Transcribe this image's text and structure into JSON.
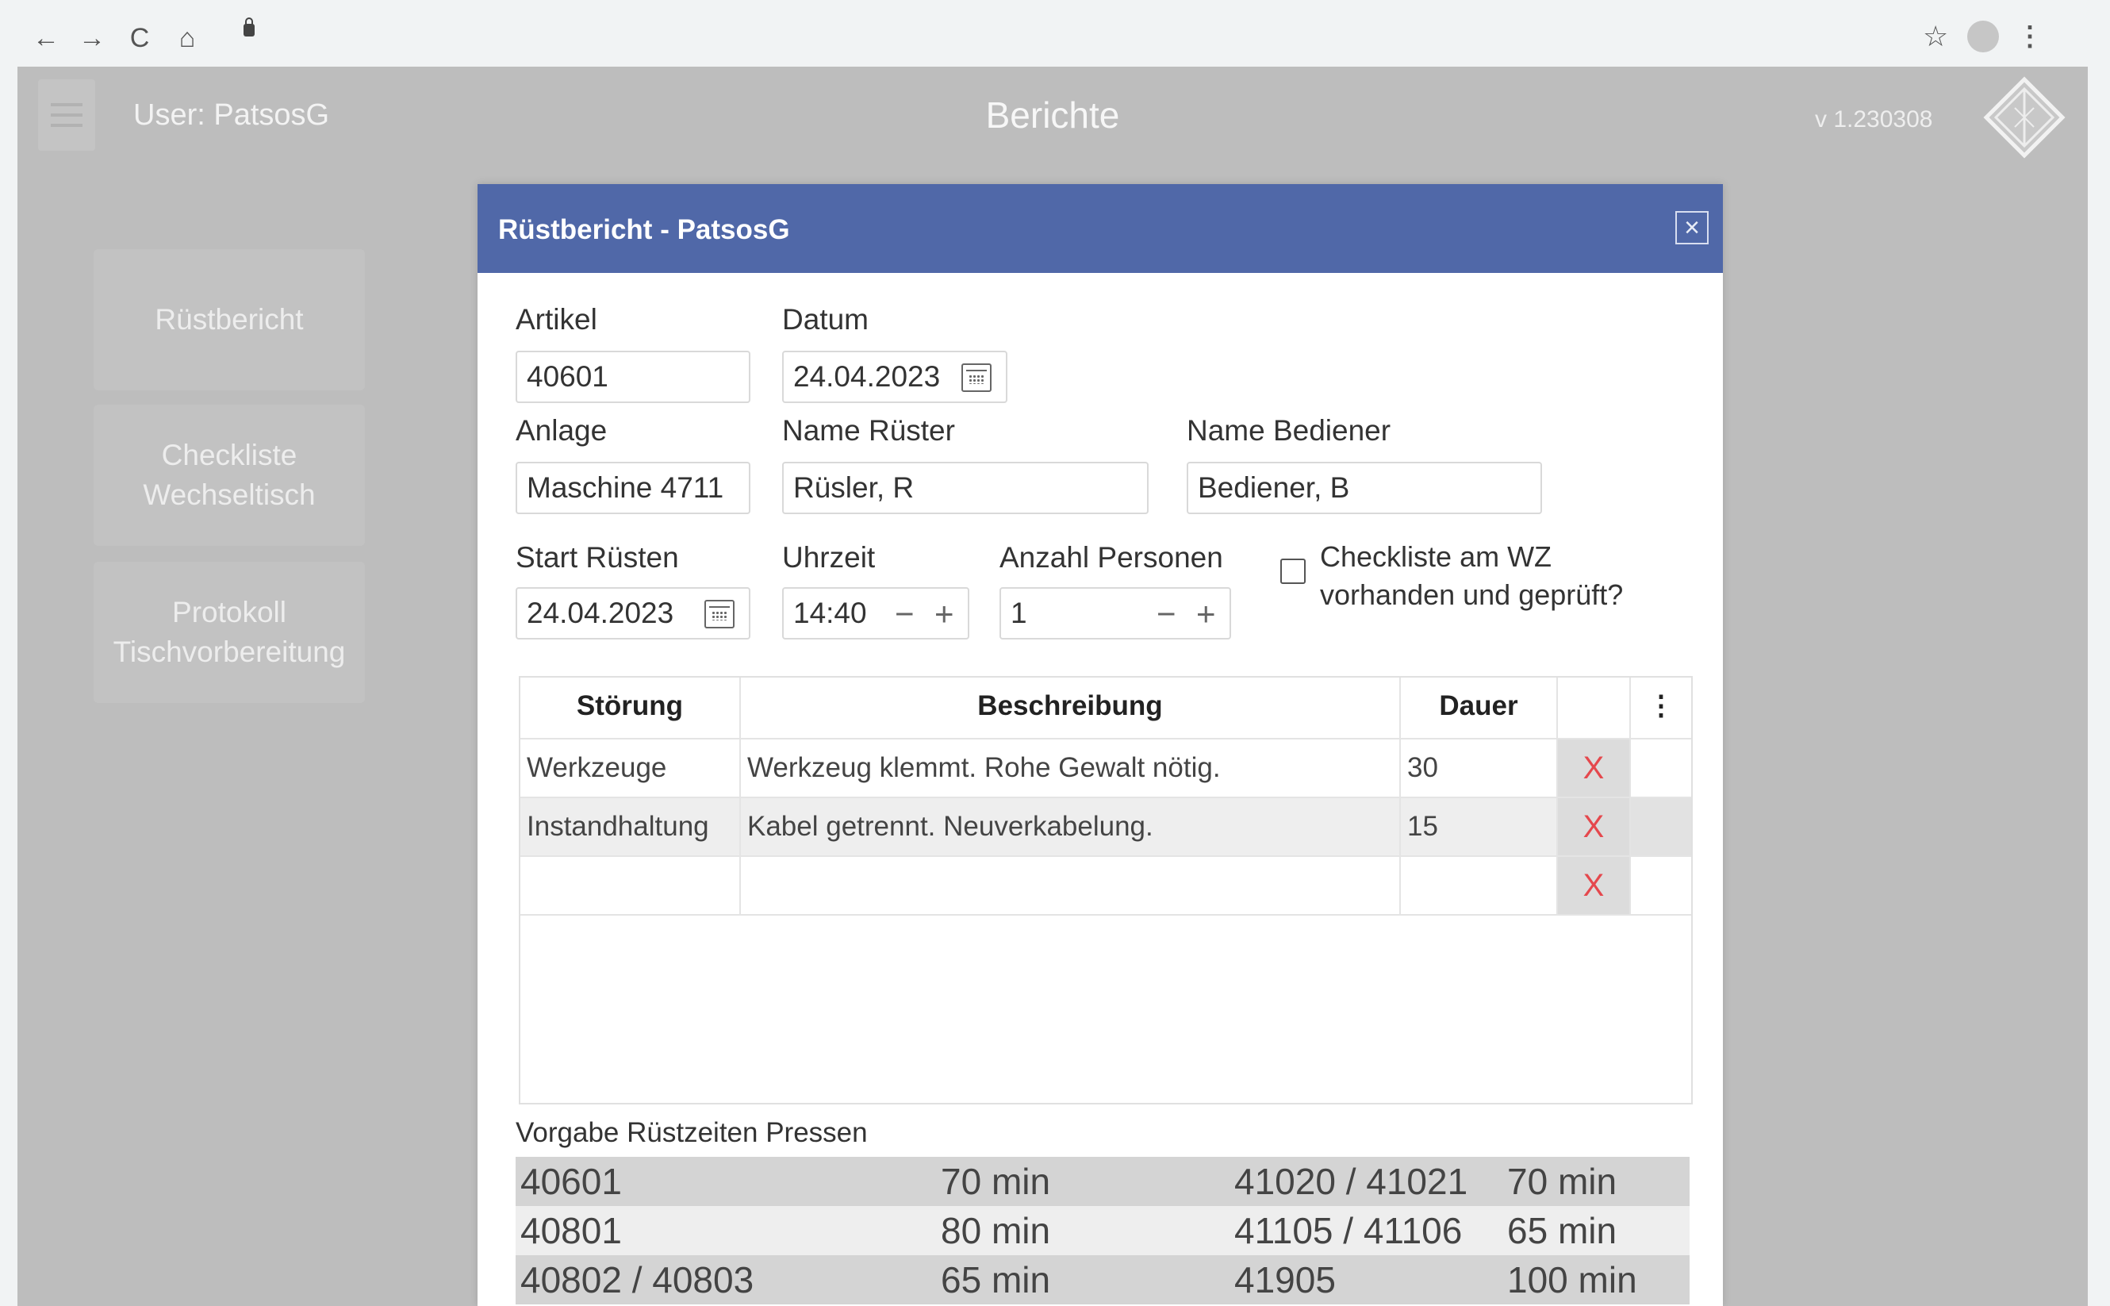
{
  "browser": {
    "back": "←",
    "forward": "→",
    "reload": "C",
    "home": "⌂",
    "star": "☆",
    "menu": "⋮"
  },
  "app": {
    "user": "User: PatsosG",
    "title": "Berichte",
    "version": "v 1.230308"
  },
  "sidebar": {
    "items": [
      {
        "label": "Rüstbericht"
      },
      {
        "label": "Checkliste Wechseltisch"
      },
      {
        "label": "Protokoll Tischvorbereitung"
      }
    ]
  },
  "dialog": {
    "title": "Rüstbericht - PatsosG",
    "close": "×",
    "fields": {
      "artikel": {
        "label": "Artikel",
        "value": "40601"
      },
      "datum": {
        "label": "Datum",
        "value": "24.04.2023"
      },
      "anlage": {
        "label": "Anlage",
        "value": "Maschine 4711"
      },
      "name_ruester": {
        "label": "Name Rüster",
        "value": "Rüsler, R"
      },
      "name_bediener": {
        "label": "Name Bediener",
        "value": "Bediener, B"
      },
      "start_ruesten": {
        "label": "Start Rüsten",
        "value": "24.04.2023"
      },
      "uhrzeit": {
        "label": "Uhrzeit",
        "value": "14:40"
      },
      "anzahl_personen": {
        "label": "Anzahl Personen",
        "value": "1"
      },
      "checkliste": {
        "label_line1": "Checkliste am WZ",
        "label_line2": "vorhanden und geprüft?",
        "checked": false
      }
    },
    "stepper": {
      "minus": "−",
      "plus": "+"
    },
    "grid": {
      "columns": [
        "Störung",
        "Beschreibung",
        "Dauer"
      ],
      "menu": "⋮",
      "delete": "X",
      "rows": [
        {
          "stoerung": "Werkzeuge",
          "beschreibung": "Werkzeug klemmt. Rohe Gewalt nötig.",
          "dauer": "30"
        },
        {
          "stoerung": "Instandhaltung",
          "beschreibung": "Kabel getrennt. Neuverkabelung.",
          "dauer": "15"
        },
        {
          "stoerung": "",
          "beschreibung": "",
          "dauer": ""
        }
      ]
    },
    "vorgabe": {
      "title": "Vorgabe Rüstzeiten Pressen",
      "rows": [
        {
          "a": "40601",
          "at": "70 min",
          "b": "41020 / 41021",
          "bt": "70 min"
        },
        {
          "a": "40801",
          "at": "80 min",
          "b": "41105 / 41106",
          "bt": "65 min"
        },
        {
          "a": "40802 / 40803",
          "at": "65 min",
          "b": "41905",
          "bt": "100 min"
        }
      ]
    }
  }
}
